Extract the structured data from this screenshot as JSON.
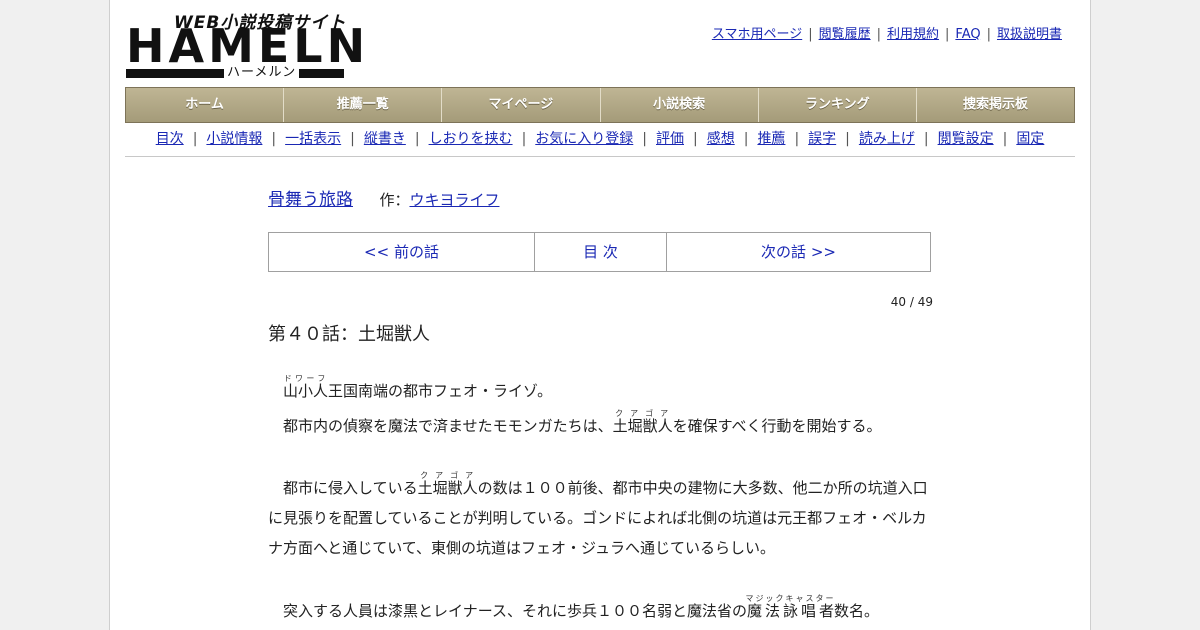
{
  "logo": {
    "subtitle": "WEB小説投稿サイト",
    "main": "HAMELN",
    "kana": "ハーメルン"
  },
  "top_links": [
    "スマホ用ページ",
    "閲覧履歴",
    "利用規約",
    "FAQ",
    "取扱説明書"
  ],
  "nav": [
    "ホーム",
    "推薦一覧",
    "マイページ",
    "小説検索",
    "ランキング",
    "捜索掲示板"
  ],
  "subnav": [
    "目次",
    "小説情報",
    "一括表示",
    "縦書き",
    "しおりを挟む",
    "お気に入り登録",
    "評価",
    "感想",
    "推薦",
    "誤字",
    "読み上げ",
    "閲覧設定",
    "固定"
  ],
  "story": {
    "title": "骨舞う旅路",
    "by_label": "作：",
    "author": "ウキヨライフ"
  },
  "pager": {
    "prev": "<< 前の話",
    "toc": "目 次",
    "next": "次の話 >>"
  },
  "chapter_count": "40 / 49",
  "chapter_title": "第４０話：土堀獣人",
  "body": {
    "p1_a_base": "山小人",
    "p1_a_ruby": "ドワーフ",
    "p1_a_rest": "王国南端の都市フェオ・ライゾ。",
    "p2_a": "都市内の偵察を魔法で済ませたモモンガたちは、",
    "p2_ruby_base": "土堀獣人",
    "p2_ruby": "クアゴア",
    "p2_b": "を確保すべく行動を開始する。",
    "p3_a": "都市に侵入している",
    "p3_ruby_base": "土堀獣人",
    "p3_ruby": "クアゴア",
    "p3_b": "の数は１００前後、都市中央の建物に大多数、他二か所の坑道入口に見張りを配置していることが判明している。ゴンドによれば北側の坑道は元王都フェオ・ベルカナ方面へと通じていて、東側の坑道はフェオ・ジュラへ通じているらしい。",
    "p4_a": "突入する人員は漆黒とレイナース、それに歩兵１００名弱と魔法省の",
    "p4_ruby_base": "魔法詠唱者",
    "p4_ruby": "マジックキャスター",
    "p4_b": "数名。"
  },
  "colors": {
    "link": "#1a28b4",
    "nav_bg": "#b0a784",
    "page_bg": "#f0f0f0"
  }
}
